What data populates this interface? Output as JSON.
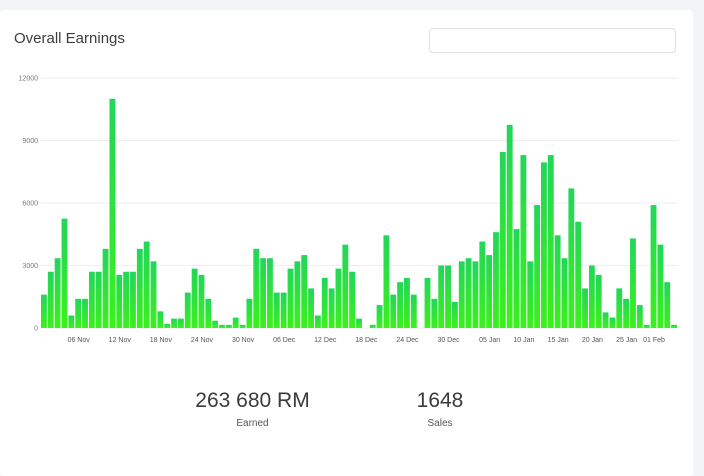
{
  "header": {
    "title": "Overall Earnings",
    "filter_value": ""
  },
  "stats": {
    "earned_value": "263 680 RM",
    "earned_label": "Earned",
    "sales_value": "1648",
    "sales_label": "Sales"
  },
  "colors": {
    "bar_top": "#22d65a",
    "bar_bottom": "#3cf01e"
  },
  "chart_data": {
    "type": "bar",
    "title": "Overall Earnings",
    "xlabel": "",
    "ylabel": "",
    "ylim": [
      0,
      12000
    ],
    "yticks": [
      0,
      3000,
      6000,
      9000,
      12000
    ],
    "grid": true,
    "xticks": [
      {
        "index": 5,
        "label": "06 Nov"
      },
      {
        "index": 11,
        "label": "12 Nov"
      },
      {
        "index": 17,
        "label": "18 Nov"
      },
      {
        "index": 23,
        "label": "24 Nov"
      },
      {
        "index": 29,
        "label": "30 Nov"
      },
      {
        "index": 35,
        "label": "06 Dec"
      },
      {
        "index": 41,
        "label": "12 Dec"
      },
      {
        "index": 47,
        "label": "18 Dec"
      },
      {
        "index": 53,
        "label": "24 Dec"
      },
      {
        "index": 59,
        "label": "30 Dec"
      },
      {
        "index": 65,
        "label": "05 Jan"
      },
      {
        "index": 70,
        "label": "10 Jan"
      },
      {
        "index": 75,
        "label": "15 Jan"
      },
      {
        "index": 80,
        "label": "20 Jan"
      },
      {
        "index": 85,
        "label": "25 Jan"
      },
      {
        "index": 89,
        "label": "01 Feb"
      }
    ],
    "values": [
      1600,
      2700,
      3350,
      5250,
      600,
      1400,
      1400,
      2700,
      2700,
      3800,
      11000,
      2550,
      2700,
      2700,
      3800,
      4150,
      3200,
      800,
      200,
      450,
      450,
      1700,
      2850,
      2550,
      1400,
      350,
      150,
      150,
      500,
      150,
      1400,
      3800,
      3350,
      3350,
      1700,
      1700,
      2850,
      3200,
      3500,
      1900,
      600,
      2400,
      1900,
      2850,
      4000,
      2700,
      450,
      0,
      150,
      1100,
      4450,
      1600,
      2200,
      2400,
      1600,
      0,
      2400,
      1400,
      3000,
      3000,
      1250,
      3200,
      3350,
      3200,
      4150,
      3500,
      4600,
      8450,
      9750,
      4750,
      8300,
      3200,
      5900,
      7950,
      8300,
      4450,
      3350,
      6700,
      5100,
      1900,
      3000,
      2550,
      750,
      500,
      1900,
      1400,
      4300,
      1100,
      150,
      5900,
      4000,
      2200,
      150
    ]
  }
}
